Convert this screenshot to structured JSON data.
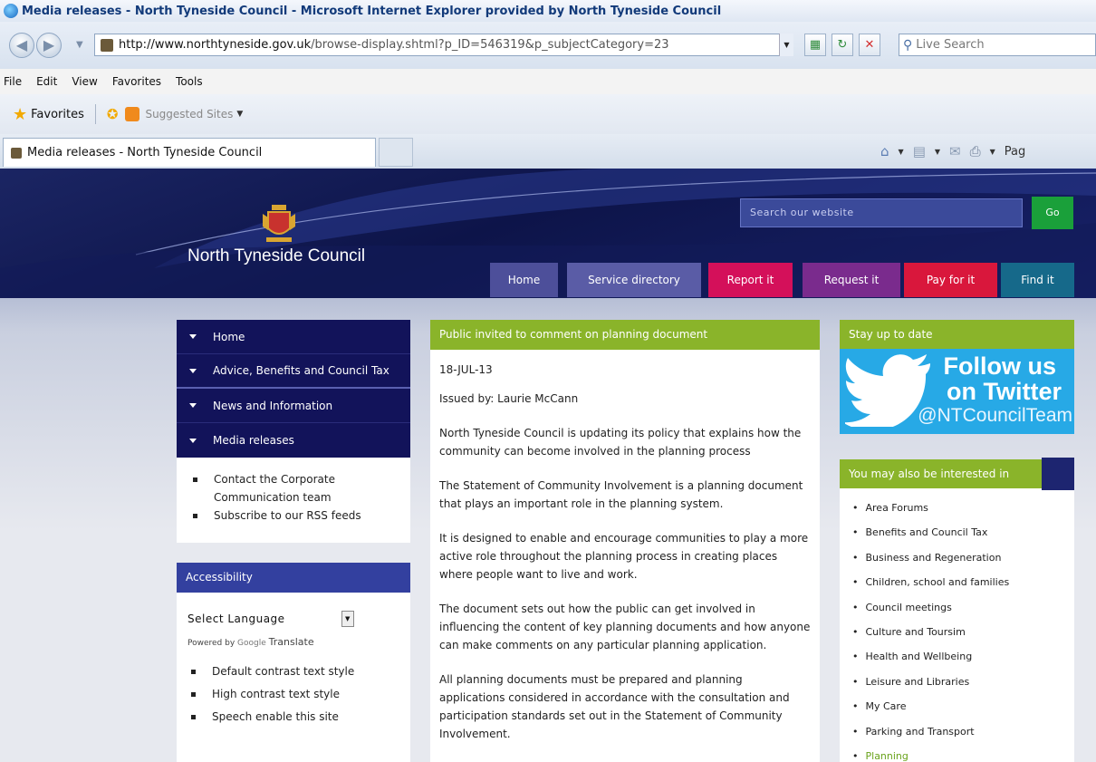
{
  "browser": {
    "window_title": "Media releases - North Tyneside Council - Microsoft Internet Explorer provided by North Tyneside Council",
    "url_domain": "http://www.northtyneside.gov.uk",
    "url_path": "/browse-display.shtml?p_ID=546319&p_subjectCategory=23",
    "search_placeholder": "Live Search",
    "menu": [
      "File",
      "Edit",
      "View",
      "Favorites",
      "Tools"
    ],
    "favorites_label": "Favorites",
    "suggested_sites_label": "Suggested Sites",
    "tab_title": "Media releases - North Tyneside Council",
    "page_menu_label": "Pag"
  },
  "site": {
    "council_name": "North Tyneside Council",
    "search_placeholder": "Search our website",
    "go_label": "Go",
    "topnav": [
      {
        "label": "Home",
        "color": "#4d4f9a"
      },
      {
        "label": "Service directory",
        "color": "#5a5ca6"
      },
      {
        "label": "Report it",
        "color": "#d4105a"
      },
      {
        "label": "Request it",
        "color": "#7a2b8d"
      },
      {
        "label": "Pay for it",
        "color": "#d9173c"
      },
      {
        "label": "Find it",
        "color": "#16698a"
      }
    ]
  },
  "left_nav": {
    "items": [
      "Home",
      "Advice, Benefits and Council Tax",
      "News and Information",
      "Media releases"
    ],
    "links": [
      "Contact the Corporate Communication team",
      "Subscribe to our RSS feeds"
    ]
  },
  "accessibility": {
    "heading": "Accessibility",
    "select_language": "Select Language",
    "powered_by": "Powered by",
    "google": "Google",
    "translate": "Translate",
    "options": [
      "Default contrast text style",
      "High contrast text style",
      "Speech enable this site"
    ]
  },
  "article": {
    "title": "Public invited to comment on planning document",
    "date": "18-JUL-13",
    "issued_by": "Issued by: Laurie McCann",
    "paragraphs": [
      "North Tyneside Council is updating its policy that explains how the community can become involved in the planning process",
      "The Statement of Community Involvement is a planning document that plays an important role in the planning system.",
      "It is designed to enable and encourage communities to play a more active role throughout the planning process in creating places where people want to live and work.",
      "The document sets out how the public can get involved in influencing the content of key planning documents and how anyone can make comments on any particular planning application.",
      "All planning documents must be prepared and planning applications considered in accordance with the consultation and participation standards set out in the Statement of Community Involvement."
    ]
  },
  "sidebar_right": {
    "stay_heading": "Stay up to date",
    "twitter_line1": "Follow us",
    "twitter_line2": "on Twitter",
    "twitter_handle": "@NTCouncilTeam",
    "interest_heading": "You may also be interested in",
    "interests": [
      "Area Forums",
      "Benefits and Council Tax",
      "Business and Regeneration",
      "Children, school and families",
      "Council meetings",
      "Culture and Toursim",
      "Health and Wellbeing",
      "Leisure and Libraries",
      "My Care",
      "Parking and Transport",
      "Planning"
    ]
  },
  "colors": {
    "header_bg": "#0d1449",
    "green_accent": "#8ab42a",
    "nav_dark": "#12135a",
    "twitter_blue": "#27a9e6"
  },
  "icons": [
    "ie-logo-icon",
    "back-arrow-icon",
    "forward-arrow-icon",
    "page-icon",
    "refresh-icon",
    "stop-icon",
    "search-icon",
    "favorites-star-icon",
    "add-favorites-icon",
    "suggested-sites-icon",
    "home-icon",
    "feeds-icon",
    "mail-icon",
    "print-icon",
    "council-crest-icon",
    "twitter-bird-icon",
    "pin-icon"
  ]
}
